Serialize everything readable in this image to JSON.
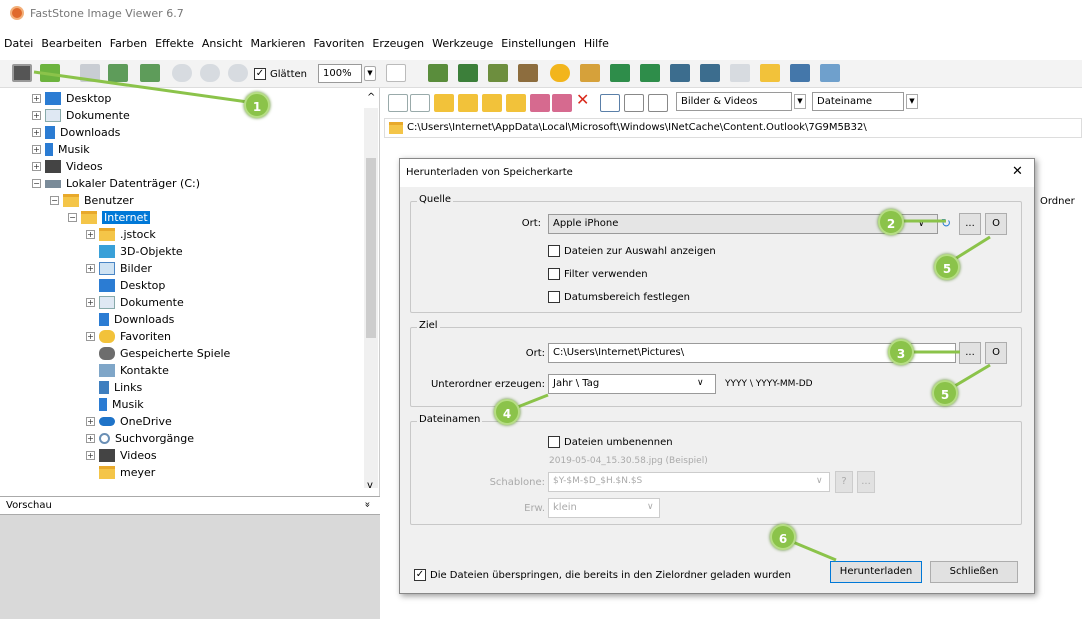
{
  "window": {
    "title": "FastStone Image Viewer 6.7"
  },
  "menu": [
    "Datei",
    "Bearbeiten",
    "Farben",
    "Effekte",
    "Ansicht",
    "Markieren",
    "Favoriten",
    "Erzeugen",
    "Werkzeuge",
    "Einstellungen",
    "Hilfe"
  ],
  "toolbar": {
    "smooth_label": "Glätten",
    "zoom_value": "100%"
  },
  "tree": {
    "items": [
      "Desktop",
      "Dokumente",
      "Downloads",
      "Musik",
      "Videos",
      "Lokaler Datenträger (C:)",
      "Benutzer",
      "Internet",
      ".jstock",
      "3D-Objekte",
      "Bilder",
      "Desktop",
      "Dokumente",
      "Downloads",
      "Favoriten",
      "Gespeicherte Spiele",
      "Kontakte",
      "Links",
      "Musik",
      "OneDrive",
      "Suchvorgänge",
      "Videos",
      "meyer"
    ]
  },
  "preview": {
    "label": "Vorschau",
    "collapse": "»"
  },
  "nav": {
    "filter_value": "Bilder & Videos",
    "sort_value": "Dateiname"
  },
  "path": "C:\\Users\\Internet\\AppData\\Local\\Microsoft\\Windows\\INetCache\\Content.Outlook\\7G9M5B32\\",
  "right_partial": "Ordner",
  "dialog": {
    "title": "Herunterladen von Speicherkarte",
    "close": "✕",
    "source": {
      "group": "Quelle",
      "ort_label": "Ort:",
      "ort_value": "Apple iPhone",
      "browse": "...",
      "o_btn": "O",
      "checks": [
        "Dateien zur Auswahl anzeigen",
        "Filter verwenden",
        "Datumsbereich festlegen"
      ]
    },
    "target": {
      "group": "Ziel",
      "ort_label": "Ort:",
      "ort_value": "C:\\Users\\Internet\\Pictures\\",
      "browse": "...",
      "o_btn": "O",
      "subfolder_label": "Unterordner erzeugen:",
      "subfolder_value": "Jahr \\ Tag",
      "subfolder_pattern": "YYYY \\ YYYY-MM-DD"
    },
    "names": {
      "group": "Dateinamen",
      "rename_label": "Dateien umbenennen",
      "example": "2019-05-04_15.30.58.jpg  (Beispiel)",
      "template_label": "Schablone:",
      "template_value": "$Y-$M-$D_$H.$N.$S",
      "help": "?",
      "more": "...",
      "ext_label": "Erw.",
      "ext_value": "klein"
    },
    "skip_label": "Die Dateien überspringen, die bereits in den Zielordner geladen wurden",
    "download_btn": "Herunterladen",
    "close_btn": "Schließen"
  },
  "badges": [
    "1",
    "2",
    "3",
    "4",
    "5",
    "5",
    "6"
  ],
  "colors": {
    "badge": "#8bc34a",
    "selection": "#0078d7",
    "folder": "#f4c548"
  }
}
